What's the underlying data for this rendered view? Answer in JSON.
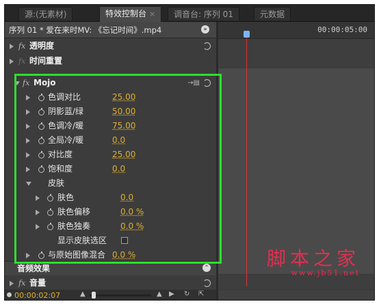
{
  "tabs": [
    {
      "label": "源:(无素材)"
    },
    {
      "label": "特效控制台",
      "close": "×"
    },
    {
      "label": "调音台: 序列 01"
    },
    {
      "label": "元数据"
    }
  ],
  "sequence_header": "序列 01 * 爱在来时MV: 《忘记时间》.mp4",
  "ruler_time": "00:00:05:00",
  "effects": [
    {
      "label": "透明度"
    },
    {
      "label": "时间重置"
    },
    {
      "label": "Mojo"
    }
  ],
  "params": [
    {
      "label": "色调对比",
      "value": "25.00"
    },
    {
      "label": "阴影蓝/绿",
      "value": "50.00"
    },
    {
      "label": "色调冷/暖",
      "value": "75.00"
    },
    {
      "label": "全局冷/暖",
      "value": "0.0"
    },
    {
      "label": "对比度",
      "value": "25.00"
    },
    {
      "label": "饱和度",
      "value": "0.0"
    }
  ],
  "skin_group": {
    "label": "皮肤"
  },
  "skin_params": [
    {
      "label": "肤色",
      "value": "0.0"
    },
    {
      "label": "肤色偏移",
      "value": "0.0 %"
    },
    {
      "label": "肤色独奏",
      "value": "0.0 %"
    }
  ],
  "show_skin": "显示皮肤选区",
  "blend": {
    "label": "与原始图像混合",
    "value": "0.0 %"
  },
  "audio_header": "音频效果",
  "volume": "音量",
  "timecode": "00:00:02:07",
  "watermark": {
    "line1": "脚本之家",
    "line2": "www.jb51.net"
  },
  "colors": {
    "accent_value": "#e0b030",
    "highlight": "#2ddf2d",
    "playhead": "#e03030"
  }
}
